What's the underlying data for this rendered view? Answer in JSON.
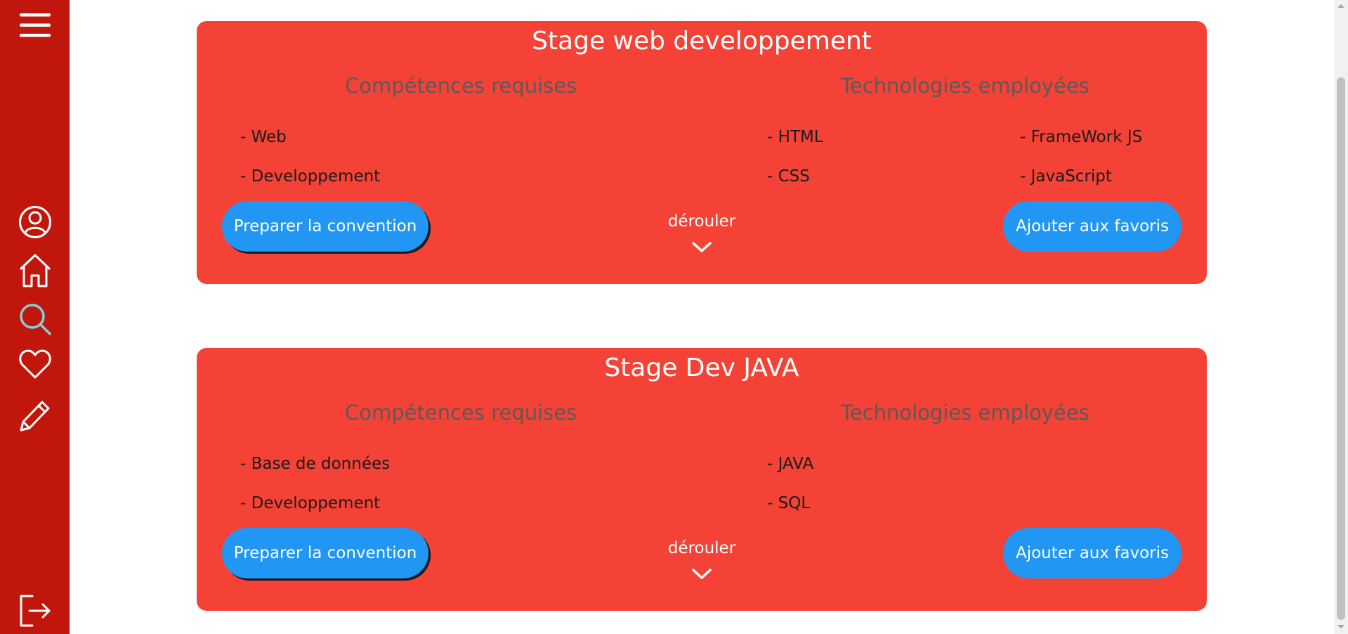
{
  "sidebar": {
    "menu_icon": "hamburger-menu-icon",
    "items": [
      {
        "icon": "user-profile-icon"
      },
      {
        "icon": "home-icon"
      },
      {
        "icon": "search-icon",
        "active": true
      },
      {
        "icon": "heart-icon"
      },
      {
        "icon": "pencil-icon"
      }
    ],
    "logout_icon": "logout-icon",
    "colors": {
      "background": "#c1160b",
      "icon": "#ffffff",
      "active_icon": "#7fd3d8"
    }
  },
  "cards": [
    {
      "title": "Stage web developpement",
      "skills_heading": "Compétences requises",
      "tech_heading": "Technologies employées",
      "skills": [
        "- Web",
        "- Developpement"
      ],
      "tech_col1": [
        "- HTML",
        "- CSS"
      ],
      "tech_col2": [
        "- FrameWork JS",
        "- JavaScript"
      ],
      "convention_button": "Preparer la convention",
      "expand_label": "dérouler",
      "favorite_button": "Ajouter aux favoris"
    },
    {
      "title": "Stage Dev JAVA",
      "skills_heading": "Compétences requises",
      "tech_heading": "Technologies employées",
      "skills": [
        "- Base de données",
        "- Developpement"
      ],
      "tech_col1": [
        "- JAVA",
        "- SQL"
      ],
      "tech_col2": [],
      "convention_button": "Preparer la convention",
      "expand_label": "dérouler",
      "favorite_button": "Ajouter aux favoris"
    }
  ],
  "colors": {
    "card_background": "#f44336",
    "button_background": "#2196f3",
    "heading_text": "#5a5a5a"
  }
}
